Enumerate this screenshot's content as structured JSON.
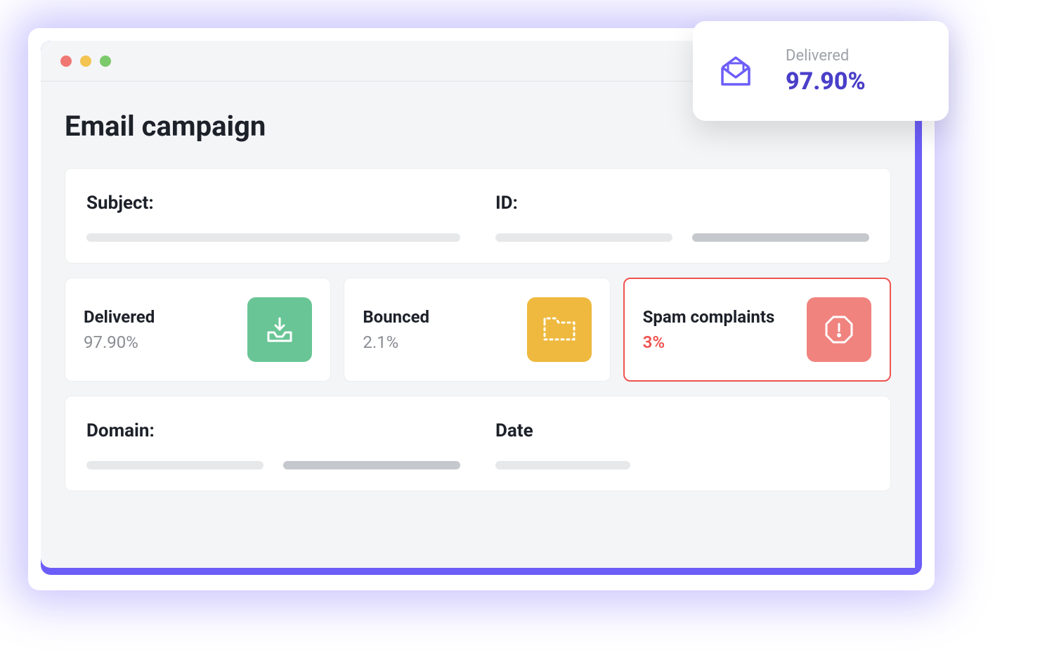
{
  "page": {
    "title": "Email campaign"
  },
  "info": {
    "subject_label": "Subject:",
    "id_label": "ID:",
    "domain_label": "Domain:",
    "date_label": "Date"
  },
  "stats": {
    "delivered": {
      "label": "Delivered",
      "value": "97.90%"
    },
    "bounced": {
      "label": "Bounced",
      "value": "2.1%"
    },
    "spam": {
      "label": "Spam complaints",
      "value": "3%"
    }
  },
  "float": {
    "label": "Delivered",
    "value": "97.90%"
  },
  "colors": {
    "accent": "#6c5df8",
    "green": "#69c595",
    "yellow": "#eeb93e",
    "red": "#f0837e",
    "alert_border": "#ef534f"
  }
}
